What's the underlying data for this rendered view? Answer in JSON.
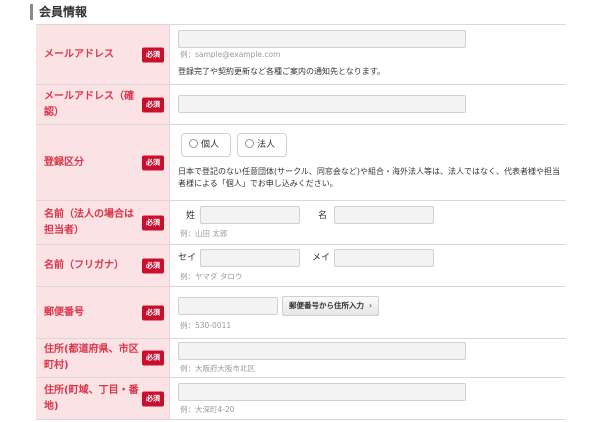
{
  "section_title": "会員情報",
  "required_badge": "必須",
  "email": {
    "label": "メールアドレス",
    "placeholder": "例：sample@example.com",
    "note": "登録完了や契約更新など各種ご案内の通知先となります。"
  },
  "email_confirm": {
    "label": "メールアドレス（確認）"
  },
  "registration_type": {
    "label": "登録区分",
    "options": [
      "個人",
      "法人"
    ],
    "note": "日本で登記のない任意団体(サークル、同窓会など)や組合・海外法人等は、法人ではなく、代表者様や担当者様による「個人」でお申し込みください。"
  },
  "name": {
    "label": "名前（法人の場合は担当者）",
    "last_label": "姓",
    "first_label": "名",
    "hint": "例：山田 太郎"
  },
  "furigana": {
    "label": "名前（フリガナ）",
    "last_label": "セイ",
    "first_label": "メイ",
    "hint": "例：ヤマダ タロウ"
  },
  "postal": {
    "label": "郵便番号",
    "button_label": "郵便番号から住所入力",
    "button_icon": "chevron-right-icon",
    "hint": "例：530-0011"
  },
  "address1": {
    "label": "住所(都道府県、市区町村)",
    "hint": "例：大阪府大阪市北区"
  },
  "address2": {
    "label": "住所(町域、丁目・番地)",
    "hint": "例：大深町4-20"
  }
}
